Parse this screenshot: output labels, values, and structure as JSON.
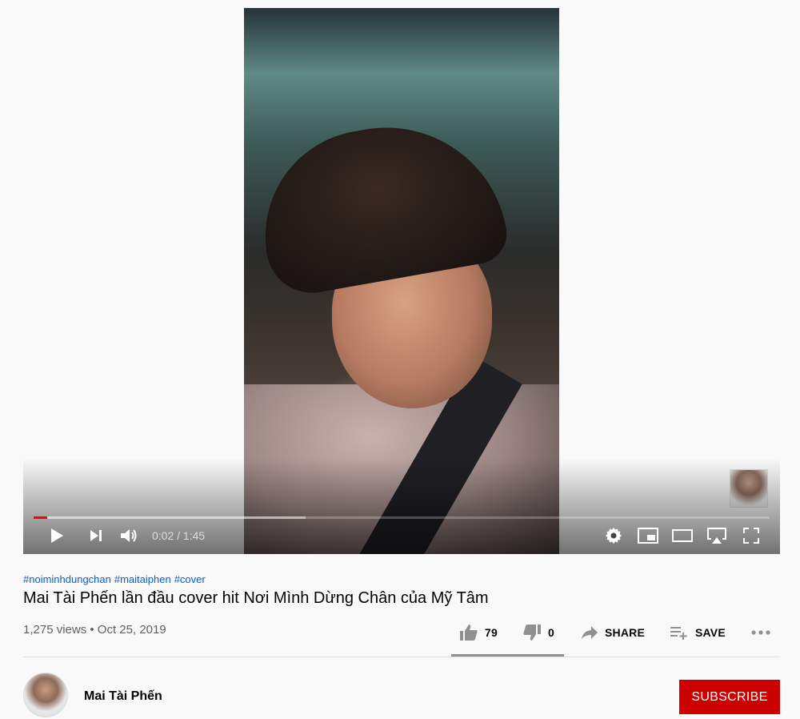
{
  "player": {
    "current_time": "0:02",
    "duration": "1:45",
    "time_display": "0:02 / 1:45",
    "played_fraction": 0.019,
    "loaded_fraction": 0.37,
    "accent_color": "#ff0000"
  },
  "video": {
    "hashtags": [
      "#noiminhdungchan",
      "#maitaiphen",
      "#cover"
    ],
    "title": "Mai Tài Phến lần đầu cover hit Nơi Mình Dừng Chân của Mỹ Tâm",
    "meta": "1,275 views • Oct 25, 2019"
  },
  "actions": {
    "like_count": "79",
    "dislike_count": "0",
    "share_label": "SHARE",
    "save_label": "SAVE"
  },
  "channel": {
    "name": "Mai Tài Phến",
    "subscribe_label": "SUBSCRIBE",
    "subscribe_color": "#cc0000"
  }
}
